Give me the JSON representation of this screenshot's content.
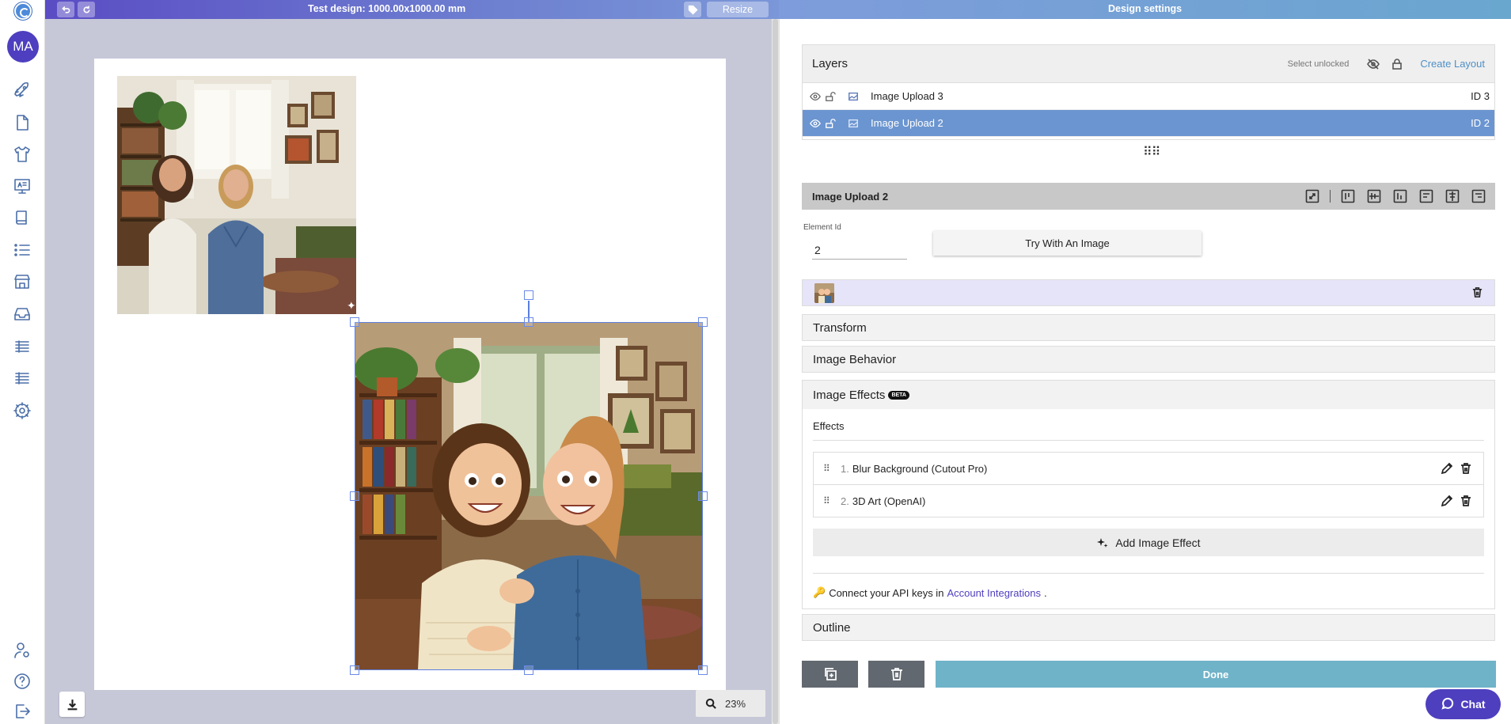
{
  "header": {
    "title": "Test design: 1000.00x1000.00 mm",
    "resize_label": "Resize",
    "panel_title": "Design settings"
  },
  "user": {
    "initials": "MA"
  },
  "layers": {
    "title": "Layers",
    "select_unlocked": "Select unlocked",
    "create_layout": "Create Layout",
    "items": [
      {
        "name": "Image Upload 3",
        "id": "ID 3",
        "selected": false
      },
      {
        "name": "Image Upload 2",
        "id": "ID 2",
        "selected": true
      }
    ]
  },
  "element": {
    "name": "Image Upload 2",
    "id_label": "Element Id",
    "id_value": "2",
    "try_button": "Try With An Image"
  },
  "sections": {
    "transform": "Transform",
    "image_behavior": "Image Behavior",
    "image_effects": "Image Effects",
    "beta": "BETA",
    "outline": "Outline"
  },
  "effects": {
    "label": "Effects",
    "items": [
      {
        "num": "1.",
        "name": "Blur Background (Cutout Pro)"
      },
      {
        "num": "2.",
        "name": "3D Art (OpenAI)"
      }
    ],
    "add_label": "Add Image Effect",
    "api_prefix": "Connect your API keys in",
    "api_link": "Account Integrations",
    "api_suffix": "."
  },
  "footer": {
    "done_label": "Done",
    "chat_label": "Chat",
    "zoom_label": "23%"
  },
  "colors": {
    "accent": "#4e3fbf",
    "selected_row": "#6b95d0",
    "done": "#6fb3c9"
  }
}
